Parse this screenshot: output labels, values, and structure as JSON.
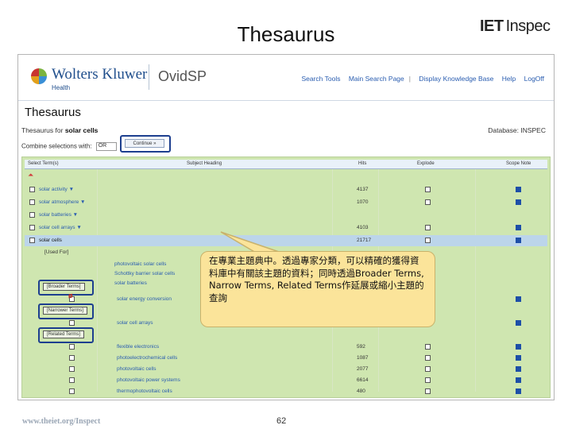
{
  "slide": {
    "title": "Thesaurus",
    "logo_iet": "IET",
    "logo_inspec": "Inspec",
    "footer_url": "www.theiet.org/Inspect",
    "page_number": "62"
  },
  "ovid": {
    "brand": "Wolters Kluwer",
    "brand_sub": "Health",
    "product": "OvidSP",
    "nav": [
      "Search Tools",
      "Main Search Page",
      "Display Knowledge Base",
      "Help",
      "LogOff"
    ]
  },
  "page": {
    "heading": "Thesaurus",
    "thesaurus_for_label": "Thesaurus for",
    "thesaurus_for_term": "solar cells",
    "database": "Database: INSPEC",
    "combine_label": "Combine selections with:",
    "combine_value": "OR",
    "continue_label": "Continue »"
  },
  "table": {
    "headers": [
      "Select Term(s)",
      "Subject Heading",
      "Hits",
      "Explode",
      "Scope Note"
    ],
    "top_rows": [
      {
        "term": "solar activity ▼",
        "hits": "4137"
      },
      {
        "term": "solar atmosphere ▼",
        "hits": "1070"
      },
      {
        "term": "solar batteries ▼",
        "hits": ""
      },
      {
        "term": "solar cell arrays ▼",
        "hits": "4103"
      },
      {
        "term": "solar cells",
        "hits": "21717"
      }
    ],
    "used_for": "[Used For]",
    "used_for_terms": [
      "photovoltaic solar cells",
      "Schottky barrier solar cells",
      "solar batteries"
    ],
    "broader_label": "[Broader Terms]",
    "broader_term": "solar energy conversion",
    "narrower_label": "[Narrower Terms]",
    "narrower_term": "solar cell arrays",
    "related_label": "[Related Terms]",
    "related_rows": [
      {
        "term": "flexible electronics",
        "hits": "592"
      },
      {
        "term": "photoelectrochemical cells",
        "hits": "1087"
      },
      {
        "term": "photovoltaic cells",
        "hits": "2077"
      },
      {
        "term": "photovoltaic power systems",
        "hits": "6614"
      },
      {
        "term": "thermophotovoltaic cells",
        "hits": "480"
      }
    ]
  },
  "callout": {
    "text": "在專業主題典中。透過專家分類，可以精確的獲得資料庫中有關該主題的資料；同時透過Broader Terms, Narrow Terms, Related Terms作延展或縮小主題的查詢"
  },
  "colors": {
    "grid_background": "#cfe6b0",
    "highlight_row": "#bcd5ea",
    "callout_fill": "#fbe49a",
    "link_blue": "#2a5db0"
  }
}
